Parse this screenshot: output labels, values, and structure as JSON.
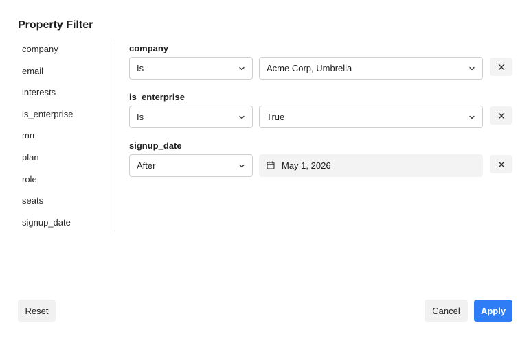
{
  "dialog": {
    "title": "Property Filter"
  },
  "properties": [
    {
      "label": "company"
    },
    {
      "label": "email"
    },
    {
      "label": "interests"
    },
    {
      "label": "is_enterprise"
    },
    {
      "label": "mrr"
    },
    {
      "label": "plan"
    },
    {
      "label": "role"
    },
    {
      "label": "seats"
    },
    {
      "label": "signup_date"
    }
  ],
  "filters": [
    {
      "property": "company",
      "operator": "Is",
      "value": "Acme Corp, Umbrella",
      "value_type": "select"
    },
    {
      "property": "is_enterprise",
      "operator": "Is",
      "value": "True",
      "value_type": "select"
    },
    {
      "property": "signup_date",
      "operator": "After",
      "value": "May 1, 2026",
      "value_type": "date"
    }
  ],
  "footer": {
    "reset_label": "Reset",
    "cancel_label": "Cancel",
    "apply_label": "Apply"
  },
  "colors": {
    "accent": "#2f7df6",
    "muted_bg": "#f3f3f3",
    "border": "#cfcfcf"
  },
  "icons": {
    "chevron": "chevron-down-icon",
    "remove": "close-icon",
    "calendar": "calendar-icon"
  }
}
